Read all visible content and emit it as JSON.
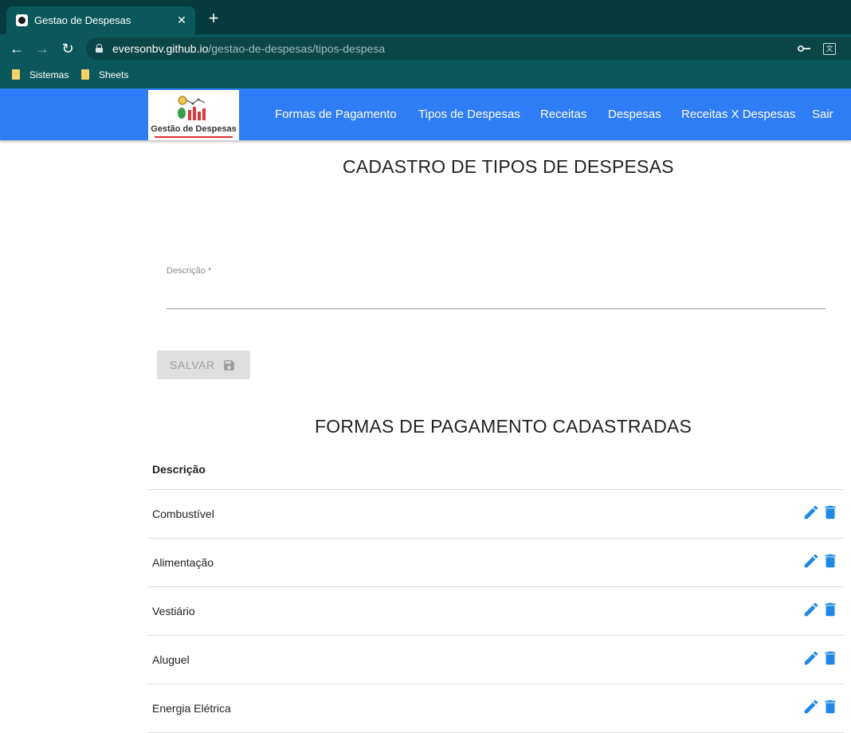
{
  "browser": {
    "tab_title": "Gestao de Despesas",
    "tab_close": "✕",
    "new_tab": "+",
    "url_host": "eversonbv.github.io",
    "url_path": "/gestao-de-despesas/tipos-despesa",
    "back": "←",
    "forward": "→",
    "reload": "↻",
    "bookmarks": [
      "Sistemas",
      "Sheets"
    ],
    "translate_glyph": "文"
  },
  "navbar": {
    "logo_text": "Gestão de Despesas",
    "links": [
      "Formas de Pagamento",
      "Tipos de Despesas",
      "Receitas",
      "Despesas",
      "Receitas X Despesas",
      "Sair"
    ]
  },
  "form": {
    "title": "CADASTRO DE TIPOS DE DESPESAS",
    "field_label": "Descrição *",
    "field_value": "",
    "save_label": "SALVAR"
  },
  "table": {
    "title": "FORMAS DE PAGAMENTO CADASTRADAS",
    "header": "Descrição",
    "rows": [
      "Combustível",
      "Alimentação",
      "Vestiário",
      "Aluguel",
      "Energia Elétrica"
    ]
  },
  "colors": {
    "navbar": "#2f7df6",
    "action_icons": "#1e88e5",
    "browser_frame": "#0b585c"
  },
  "icons": {
    "edit": "pencil-icon",
    "delete": "trash-icon",
    "save": "floppy-disk-icon"
  }
}
